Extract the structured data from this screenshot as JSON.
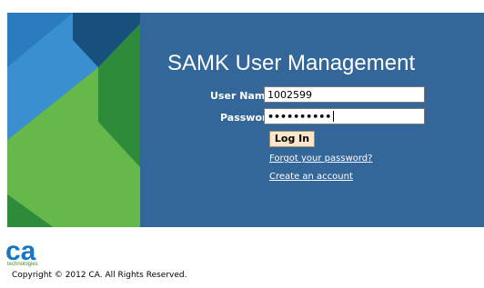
{
  "app": {
    "title": "SAMK User Management"
  },
  "login_form": {
    "username_label": "User Name:",
    "username_value": "1002599",
    "password_label": "Password:",
    "password_value": "••••••••••",
    "login_button": "Log In",
    "forgot_link": "Forgot your password?",
    "create_link": "Create an account"
  },
  "footer": {
    "logo_text": "ca",
    "logo_subtext": "technologies",
    "copyright": "Copyright © 2012 CA. All Rights Reserved."
  },
  "colors": {
    "banner_blue": "#336699",
    "green_light": "#66b84a",
    "green_dark": "#2e8b3a",
    "blue_dark": "#1a4f7a",
    "logo_blue": "#1877c5"
  }
}
